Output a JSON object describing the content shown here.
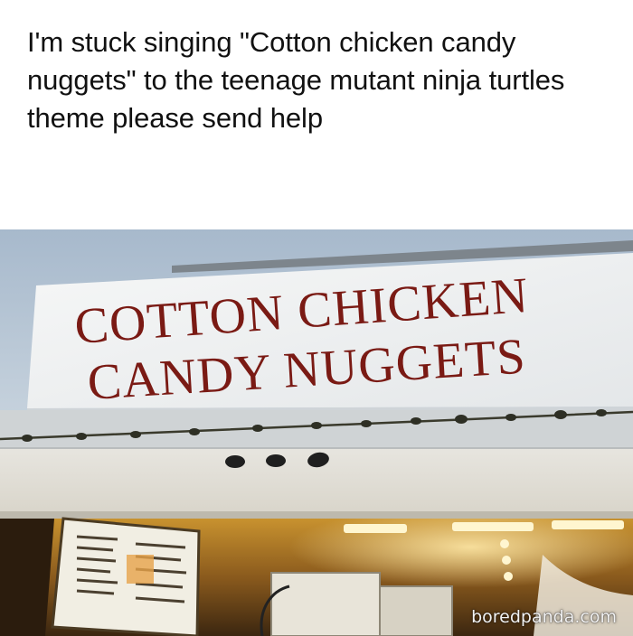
{
  "caption": "I'm stuck singing \"Cotton chicken candy nuggets\" to the teenage mutant ninja turtles theme please send help",
  "sign": {
    "line1": "COTTON CHICKEN",
    "line2": "CANDY NUGGETS"
  },
  "watermark": "boredpanda.com",
  "colors": {
    "sign_text": "#7a1a14",
    "sign_board": "#f3f5f6",
    "sky": "#aebfd0",
    "awning": "#e9e6dc"
  }
}
